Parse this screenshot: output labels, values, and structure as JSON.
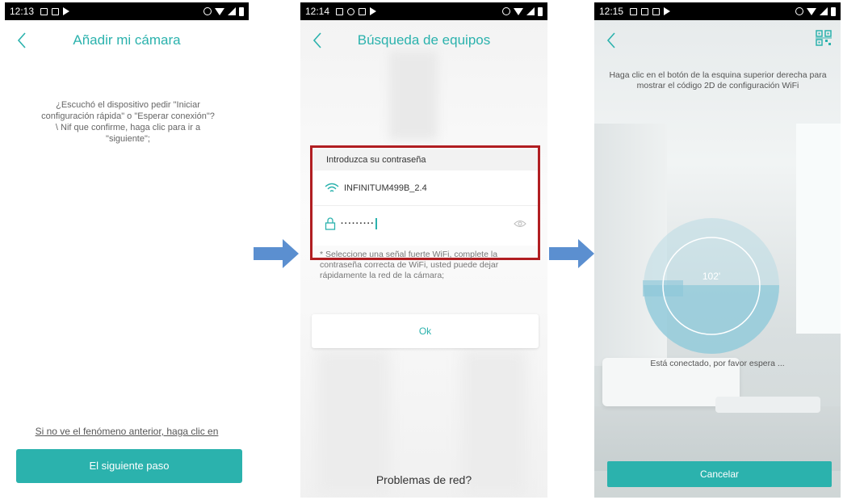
{
  "screens": [
    {
      "status_time": "12:13",
      "title": "Añadir mi cámara",
      "question": "¿Escuchó el dispositivo pedir \"Iniciar configuración rápida\" o \"Esperar conexión\"? \\ Nif que confirme, haga clic para ir a \"siguiente\";",
      "link": "Si no ve el fenómeno anterior, haga clic en",
      "next_button": "El siguiente paso"
    },
    {
      "status_time": "12:14",
      "title": "Búsqueda de equipos",
      "dialog_title": "Introduzca su contraseña",
      "wifi_name": "INFINITUM499B_2.4",
      "password_mask": "·········",
      "hint": "* Seleccione una señal fuerte WiFi, complete la contraseña correcta de WiFi, usted puede dejar rápidamente la red de la cámara;",
      "ok_button": "Ok",
      "problems": "Problemas de red?"
    },
    {
      "status_time": "12:15",
      "instruction": "Haga clic en el botón de la esquina superior derecha para mostrar el código 2D de configuración WiFi",
      "progress_value": "102'",
      "connected_text": "Está conectado, por favor espera ...",
      "cancel_button": "Cancelar"
    }
  ],
  "colors": {
    "accent": "#2bb2ad",
    "highlight_frame": "#b11e22",
    "arrow": "#5b8fd0"
  },
  "icons": [
    "back-icon",
    "wifi-icon",
    "lock-icon",
    "eye-icon",
    "qr-code-icon",
    "arrow-right-icon"
  ]
}
